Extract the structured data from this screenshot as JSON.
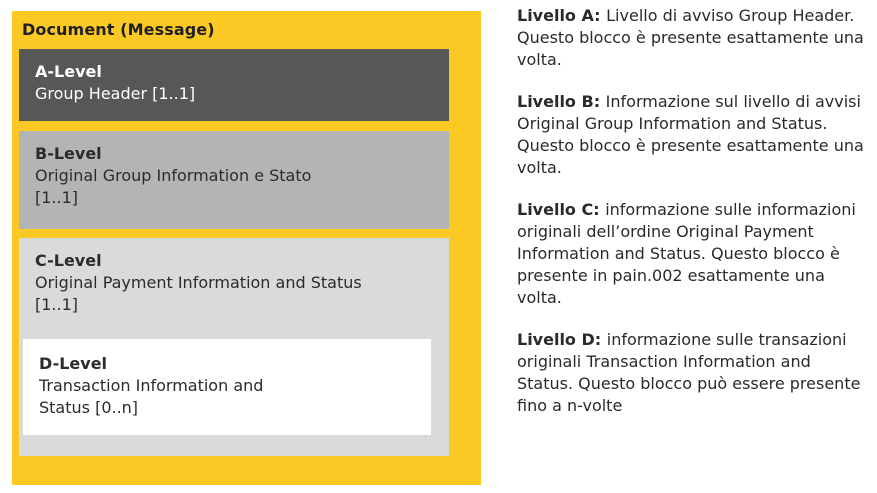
{
  "diagram": {
    "title": "Document (Message)",
    "levels": {
      "a": {
        "name": "A-Level",
        "desc": "Group Header [1..1]"
      },
      "b": {
        "name": "B-Level",
        "desc": "Original Group Information e Stato [1..1]"
      },
      "c": {
        "name": "C-Level",
        "desc": "Original Payment Information and Status [1..1]"
      },
      "d": {
        "name": "D-Level",
        "desc": "Transaction Information and Status [0..n]"
      }
    }
  },
  "descriptions": [
    {
      "head": "Livello A:",
      "text": "Livello di avviso Group Header. Questo blocco è presente esattamente una volta."
    },
    {
      "head": "Livello B:",
      "text": "Informazione sul livello di avvisi Original Group Information and Status. Questo blocco è presente esattamente una volta."
    },
    {
      "head": "Livello C:",
      "text": "informazione sulle informazi­oni originali dell’ordine Original Payment Information and Status. Questo blocco è presente in pain.002 esattamente una volta."
    },
    {
      "head": "Livello D:",
      "text": "informazione sulle transazioni originali Transaction Information and Status. Questo blocco può essere presente fino a n-volte"
    }
  ],
  "colors": {
    "frame": "#fbc923",
    "level_a": "#575756",
    "level_b": "#b4b4b4",
    "level_c": "#dadada",
    "level_d": "#ffffff"
  }
}
